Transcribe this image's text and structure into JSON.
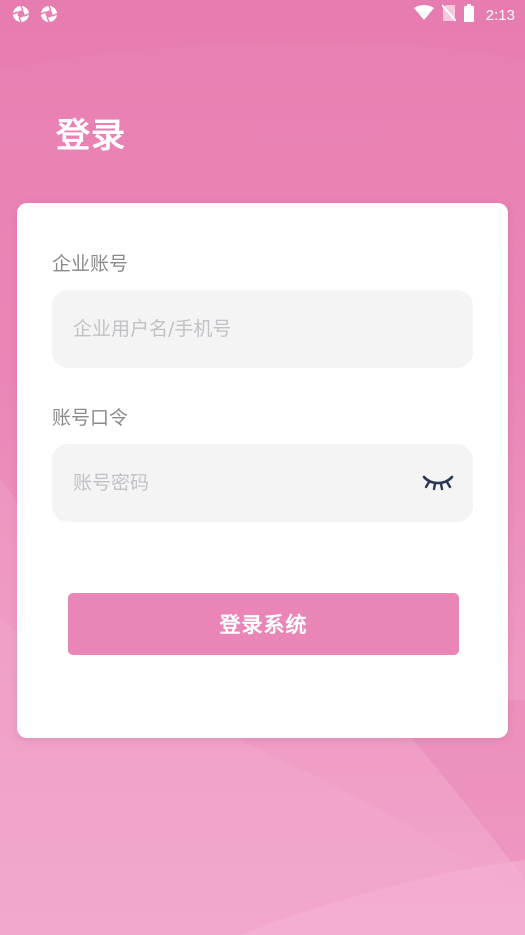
{
  "status_bar": {
    "time": "2:13",
    "left_icons": [
      "aperture-icon",
      "aperture-icon"
    ],
    "right_icons": [
      "wifi-icon",
      "no-sim-icon",
      "battery-icon"
    ]
  },
  "page": {
    "title": "登录"
  },
  "form": {
    "account": {
      "label": "企业账号",
      "placeholder": "企业用户名/手机号",
      "value": ""
    },
    "password": {
      "label": "账号口令",
      "placeholder": "账号密码",
      "value": "",
      "toggle_icon": "eye-closed-icon"
    },
    "submit_label": "登录系统"
  },
  "colors": {
    "background": "#e97fb2",
    "button": "#e985b7",
    "card": "#ffffff",
    "input_bg": "#f4f4f5",
    "label": "#8a8a8a",
    "placeholder": "#c2c2c6",
    "eye_icon": "#2b3553"
  }
}
